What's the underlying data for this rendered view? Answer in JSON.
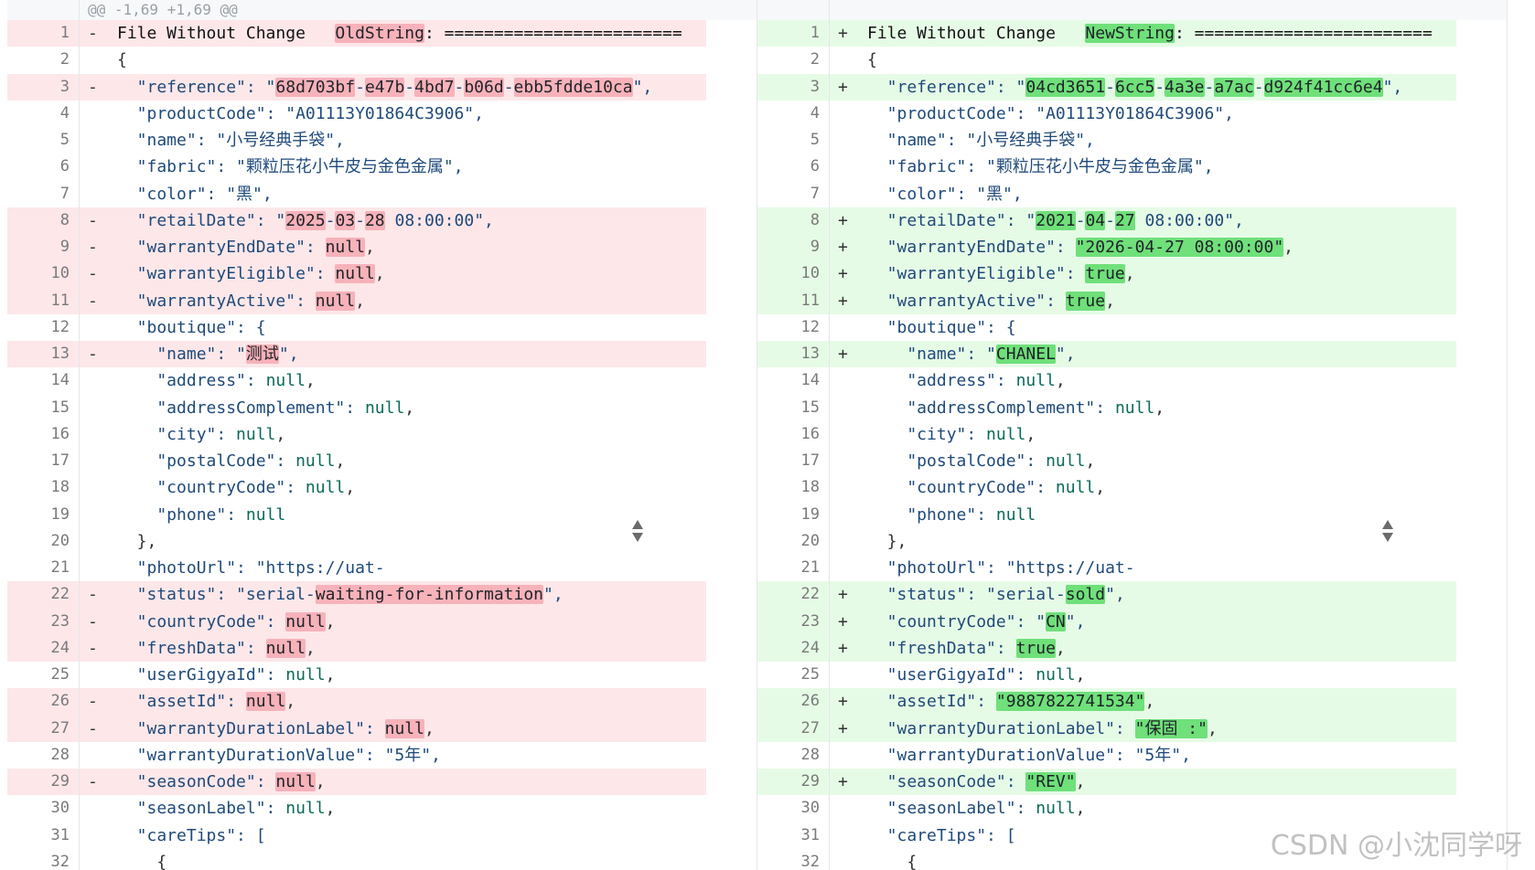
{
  "hunk_header": "@@ -1,69 +1,69 @@",
  "colors": {
    "del_bg": "#fde7e9",
    "add_bg": "#e6fbe6",
    "del_hl": "#f7b2ba",
    "add_hl": "#6fe07a"
  },
  "left": {
    "lines": [
      {
        "n": "1",
        "m": "-",
        "type": "del",
        "seg": [
          [
            "t",
            "File Without Change   "
          ],
          [
            "hl",
            "OldString"
          ],
          [
            "t",
            ": ========================"
          ]
        ]
      },
      {
        "n": "2",
        "m": "",
        "type": "ctx",
        "seg": [
          [
            "p",
            "{"
          ]
        ]
      },
      {
        "n": "3",
        "m": "-",
        "type": "del",
        "seg": [
          [
            "s",
            "  \"reference\": \""
          ],
          [
            "hl",
            "68d703bf"
          ],
          [
            "s",
            "-"
          ],
          [
            "hl",
            "e47b"
          ],
          [
            "s",
            "-"
          ],
          [
            "hl",
            "4bd7"
          ],
          [
            "s",
            "-"
          ],
          [
            "hl",
            "b06d"
          ],
          [
            "s",
            "-"
          ],
          [
            "hl",
            "ebb5fdde10ca"
          ],
          [
            "s",
            "\","
          ]
        ]
      },
      {
        "n": "4",
        "m": "",
        "type": "ctx",
        "seg": [
          [
            "s",
            "  \"productCode\": \"A01113Y01864C3906\","
          ]
        ]
      },
      {
        "n": "5",
        "m": "",
        "type": "ctx",
        "seg": [
          [
            "s",
            "  \"name\": \"小号经典手袋\","
          ]
        ]
      },
      {
        "n": "6",
        "m": "",
        "type": "ctx",
        "seg": [
          [
            "s",
            "  \"fabric\": \"颗粒压花小牛皮与金色金属\","
          ]
        ]
      },
      {
        "n": "7",
        "m": "",
        "type": "ctx",
        "seg": [
          [
            "s",
            "  \"color\": \"黑\","
          ]
        ]
      },
      {
        "n": "8",
        "m": "-",
        "type": "del",
        "seg": [
          [
            "s",
            "  \"retailDate\": \""
          ],
          [
            "hl",
            "2025"
          ],
          [
            "s",
            "-"
          ],
          [
            "hl",
            "03"
          ],
          [
            "s",
            "-"
          ],
          [
            "hl",
            "28"
          ],
          [
            "s",
            " 08:00:00\","
          ]
        ]
      },
      {
        "n": "9",
        "m": "-",
        "type": "del",
        "seg": [
          [
            "s",
            "  \"warrantyEndDate\": "
          ],
          [
            "hl",
            "null"
          ],
          [
            "p",
            ","
          ]
        ]
      },
      {
        "n": "10",
        "m": "-",
        "type": "del",
        "seg": [
          [
            "s",
            "  \"warrantyEligible\": "
          ],
          [
            "hl",
            "null"
          ],
          [
            "p",
            ","
          ]
        ]
      },
      {
        "n": "11",
        "m": "-",
        "type": "del",
        "seg": [
          [
            "s",
            "  \"warrantyActive\": "
          ],
          [
            "hl",
            "null"
          ],
          [
            "p",
            ","
          ]
        ]
      },
      {
        "n": "12",
        "m": "",
        "type": "ctx",
        "seg": [
          [
            "s",
            "  \"boutique\": {"
          ]
        ]
      },
      {
        "n": "13",
        "m": "-",
        "type": "del",
        "seg": [
          [
            "s",
            "    \"name\": \""
          ],
          [
            "hl",
            "测试"
          ],
          [
            "s",
            "\","
          ]
        ]
      },
      {
        "n": "14",
        "m": "",
        "type": "ctx",
        "seg": [
          [
            "s",
            "    \"address\": "
          ],
          [
            "n",
            "null"
          ],
          [
            "p",
            ","
          ]
        ]
      },
      {
        "n": "15",
        "m": "",
        "type": "ctx",
        "seg": [
          [
            "s",
            "    \"addressComplement\": "
          ],
          [
            "n",
            "null"
          ],
          [
            "p",
            ","
          ]
        ]
      },
      {
        "n": "16",
        "m": "",
        "type": "ctx",
        "seg": [
          [
            "s",
            "    \"city\": "
          ],
          [
            "n",
            "null"
          ],
          [
            "p",
            ","
          ]
        ]
      },
      {
        "n": "17",
        "m": "",
        "type": "ctx",
        "seg": [
          [
            "s",
            "    \"postalCode\": "
          ],
          [
            "n",
            "null"
          ],
          [
            "p",
            ","
          ]
        ]
      },
      {
        "n": "18",
        "m": "",
        "type": "ctx",
        "seg": [
          [
            "s",
            "    \"countryCode\": "
          ],
          [
            "n",
            "null"
          ],
          [
            "p",
            ","
          ]
        ]
      },
      {
        "n": "19",
        "m": "",
        "type": "ctx",
        "seg": [
          [
            "s",
            "    \"phone\": "
          ],
          [
            "n",
            "null"
          ]
        ]
      },
      {
        "n": "20",
        "m": "",
        "type": "ctx",
        "seg": [
          [
            "p",
            "  },"
          ]
        ]
      },
      {
        "n": "21",
        "m": "",
        "type": "ctx",
        "seg": [
          [
            "s",
            "  \"photoUrl\": \"https://uat-"
          ]
        ]
      },
      {
        "n": "22",
        "m": "-",
        "type": "del",
        "seg": [
          [
            "s",
            "  \"status\": \"serial-"
          ],
          [
            "hl",
            "waiting-for-information"
          ],
          [
            "s",
            "\","
          ]
        ]
      },
      {
        "n": "23",
        "m": "-",
        "type": "del",
        "seg": [
          [
            "s",
            "  \"countryCode\": "
          ],
          [
            "hl",
            "null"
          ],
          [
            "p",
            ","
          ]
        ]
      },
      {
        "n": "24",
        "m": "-",
        "type": "del",
        "seg": [
          [
            "s",
            "  \"freshData\": "
          ],
          [
            "hl",
            "null"
          ],
          [
            "p",
            ","
          ]
        ]
      },
      {
        "n": "25",
        "m": "",
        "type": "ctx",
        "seg": [
          [
            "s",
            "  \"userGigyaId\": "
          ],
          [
            "n",
            "null"
          ],
          [
            "p",
            ","
          ]
        ]
      },
      {
        "n": "26",
        "m": "-",
        "type": "del",
        "seg": [
          [
            "s",
            "  \"assetId\": "
          ],
          [
            "hl",
            "null"
          ],
          [
            "p",
            ","
          ]
        ]
      },
      {
        "n": "27",
        "m": "-",
        "type": "del",
        "seg": [
          [
            "s",
            "  \"warrantyDurationLabel\": "
          ],
          [
            "hl",
            "null"
          ],
          [
            "p",
            ","
          ]
        ]
      },
      {
        "n": "28",
        "m": "",
        "type": "ctx",
        "seg": [
          [
            "s",
            "  \"warrantyDurationValue\": \"5年\","
          ]
        ]
      },
      {
        "n": "29",
        "m": "-",
        "type": "del",
        "seg": [
          [
            "s",
            "  \"seasonCode\": "
          ],
          [
            "hl",
            "null"
          ],
          [
            "p",
            ","
          ]
        ]
      },
      {
        "n": "30",
        "m": "",
        "type": "ctx",
        "seg": [
          [
            "s",
            "  \"seasonLabel\": "
          ],
          [
            "n",
            "null"
          ],
          [
            "p",
            ","
          ]
        ]
      },
      {
        "n": "31",
        "m": "",
        "type": "ctx",
        "seg": [
          [
            "s",
            "  \"careTips\": ["
          ]
        ]
      },
      {
        "n": "32",
        "m": "",
        "type": "ctx",
        "seg": [
          [
            "p",
            "    {"
          ]
        ]
      }
    ]
  },
  "right": {
    "lines": [
      {
        "n": "1",
        "m": "+",
        "type": "add",
        "seg": [
          [
            "t",
            "File Without Change   "
          ],
          [
            "hl",
            "NewString"
          ],
          [
            "t",
            ": ========================"
          ]
        ]
      },
      {
        "n": "2",
        "m": "",
        "type": "ctx",
        "seg": [
          [
            "p",
            "{"
          ]
        ]
      },
      {
        "n": "3",
        "m": "+",
        "type": "add",
        "seg": [
          [
            "s",
            "  \"reference\": \""
          ],
          [
            "hl",
            "04cd3651"
          ],
          [
            "s",
            "-"
          ],
          [
            "hl",
            "6cc5"
          ],
          [
            "s",
            "-"
          ],
          [
            "hl",
            "4a3e"
          ],
          [
            "s",
            "-"
          ],
          [
            "hl",
            "a7ac"
          ],
          [
            "s",
            "-"
          ],
          [
            "hl",
            "d924f41cc6e4"
          ],
          [
            "s",
            "\","
          ]
        ]
      },
      {
        "n": "4",
        "m": "",
        "type": "ctx",
        "seg": [
          [
            "s",
            "  \"productCode\": \"A01113Y01864C3906\","
          ]
        ]
      },
      {
        "n": "5",
        "m": "",
        "type": "ctx",
        "seg": [
          [
            "s",
            "  \"name\": \"小号经典手袋\","
          ]
        ]
      },
      {
        "n": "6",
        "m": "",
        "type": "ctx",
        "seg": [
          [
            "s",
            "  \"fabric\": \"颗粒压花小牛皮与金色金属\","
          ]
        ]
      },
      {
        "n": "7",
        "m": "",
        "type": "ctx",
        "seg": [
          [
            "s",
            "  \"color\": \"黑\","
          ]
        ]
      },
      {
        "n": "8",
        "m": "+",
        "type": "add",
        "seg": [
          [
            "s",
            "  \"retailDate\": \""
          ],
          [
            "hl",
            "2021"
          ],
          [
            "s",
            "-"
          ],
          [
            "hl",
            "04"
          ],
          [
            "s",
            "-"
          ],
          [
            "hl",
            "27"
          ],
          [
            "s",
            " 08:00:00\","
          ]
        ]
      },
      {
        "n": "9",
        "m": "+",
        "type": "add",
        "seg": [
          [
            "s",
            "  \"warrantyEndDate\": "
          ],
          [
            "hl",
            "\"2026-04-27 08:00:00\""
          ],
          [
            "p",
            ","
          ]
        ]
      },
      {
        "n": "10",
        "m": "+",
        "type": "add",
        "seg": [
          [
            "s",
            "  \"warrantyEligible\": "
          ],
          [
            "hl",
            "true"
          ],
          [
            "p",
            ","
          ]
        ]
      },
      {
        "n": "11",
        "m": "+",
        "type": "add",
        "seg": [
          [
            "s",
            "  \"warrantyActive\": "
          ],
          [
            "hl",
            "true"
          ],
          [
            "p",
            ","
          ]
        ]
      },
      {
        "n": "12",
        "m": "",
        "type": "ctx",
        "seg": [
          [
            "s",
            "  \"boutique\": {"
          ]
        ]
      },
      {
        "n": "13",
        "m": "+",
        "type": "add",
        "seg": [
          [
            "s",
            "    \"name\": \""
          ],
          [
            "hl",
            "CHANEL"
          ],
          [
            "s",
            "\","
          ]
        ]
      },
      {
        "n": "14",
        "m": "",
        "type": "ctx",
        "seg": [
          [
            "s",
            "    \"address\": "
          ],
          [
            "n",
            "null"
          ],
          [
            "p",
            ","
          ]
        ]
      },
      {
        "n": "15",
        "m": "",
        "type": "ctx",
        "seg": [
          [
            "s",
            "    \"addressComplement\": "
          ],
          [
            "n",
            "null"
          ],
          [
            "p",
            ","
          ]
        ]
      },
      {
        "n": "16",
        "m": "",
        "type": "ctx",
        "seg": [
          [
            "s",
            "    \"city\": "
          ],
          [
            "n",
            "null"
          ],
          [
            "p",
            ","
          ]
        ]
      },
      {
        "n": "17",
        "m": "",
        "type": "ctx",
        "seg": [
          [
            "s",
            "    \"postalCode\": "
          ],
          [
            "n",
            "null"
          ],
          [
            "p",
            ","
          ]
        ]
      },
      {
        "n": "18",
        "m": "",
        "type": "ctx",
        "seg": [
          [
            "s",
            "    \"countryCode\": "
          ],
          [
            "n",
            "null"
          ],
          [
            "p",
            ","
          ]
        ]
      },
      {
        "n": "19",
        "m": "",
        "type": "ctx",
        "seg": [
          [
            "s",
            "    \"phone\": "
          ],
          [
            "n",
            "null"
          ]
        ]
      },
      {
        "n": "20",
        "m": "",
        "type": "ctx",
        "seg": [
          [
            "p",
            "  },"
          ]
        ]
      },
      {
        "n": "21",
        "m": "",
        "type": "ctx",
        "seg": [
          [
            "s",
            "  \"photoUrl\": \"https://uat-"
          ]
        ]
      },
      {
        "n": "22",
        "m": "+",
        "type": "add",
        "seg": [
          [
            "s",
            "  \"status\": \"serial-"
          ],
          [
            "hl",
            "sold"
          ],
          [
            "s",
            "\","
          ]
        ]
      },
      {
        "n": "23",
        "m": "+",
        "type": "add",
        "seg": [
          [
            "s",
            "  \"countryCode\": \""
          ],
          [
            "hl",
            "CN"
          ],
          [
            "s",
            "\","
          ]
        ]
      },
      {
        "n": "24",
        "m": "+",
        "type": "add",
        "seg": [
          [
            "s",
            "  \"freshData\": "
          ],
          [
            "hl",
            "true"
          ],
          [
            "p",
            ","
          ]
        ]
      },
      {
        "n": "25",
        "m": "",
        "type": "ctx",
        "seg": [
          [
            "s",
            "  \"userGigyaId\": "
          ],
          [
            "n",
            "null"
          ],
          [
            "p",
            ","
          ]
        ]
      },
      {
        "n": "26",
        "m": "+",
        "type": "add",
        "seg": [
          [
            "s",
            "  \"assetId\": "
          ],
          [
            "hl",
            "\"9887822741534\""
          ],
          [
            "p",
            ","
          ]
        ]
      },
      {
        "n": "27",
        "m": "+",
        "type": "add",
        "seg": [
          [
            "s",
            "  \"warrantyDurationLabel\": "
          ],
          [
            "hl",
            "\"保固 :\""
          ],
          [
            "p",
            ","
          ]
        ]
      },
      {
        "n": "28",
        "m": "",
        "type": "ctx",
        "seg": [
          [
            "s",
            "  \"warrantyDurationValue\": \"5年\","
          ]
        ]
      },
      {
        "n": "29",
        "m": "+",
        "type": "add",
        "seg": [
          [
            "s",
            "  \"seasonCode\": "
          ],
          [
            "hl",
            "\"REV\""
          ],
          [
            "p",
            ","
          ]
        ]
      },
      {
        "n": "30",
        "m": "",
        "type": "ctx",
        "seg": [
          [
            "s",
            "  \"seasonLabel\": "
          ],
          [
            "n",
            "null"
          ],
          [
            "p",
            ","
          ]
        ]
      },
      {
        "n": "31",
        "m": "",
        "type": "ctx",
        "seg": [
          [
            "s",
            "  \"careTips\": ["
          ]
        ]
      },
      {
        "n": "32",
        "m": "",
        "type": "ctx",
        "seg": [
          [
            "p",
            "    {"
          ]
        ]
      }
    ]
  },
  "watermark": "CSDN @小沈同学呀"
}
